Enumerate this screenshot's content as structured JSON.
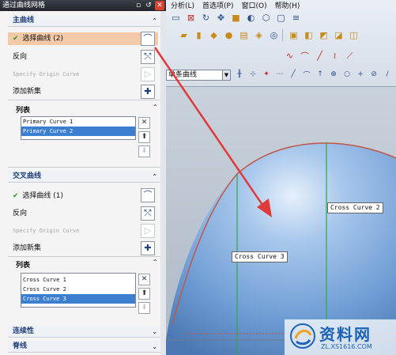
{
  "dialog": {
    "title": "通过曲线网格",
    "primary": {
      "header": "主曲线",
      "select_curve": "选择曲线 (2)",
      "reverse": "反向",
      "specify_origin": "Specify Origin Curve",
      "add_set": "添加新集",
      "list_header": "列表",
      "items": [
        "Primary Curve  1",
        "Primary Curve  2"
      ],
      "selected_index": 1
    },
    "cross": {
      "header": "交叉曲线",
      "select_curve": "选择曲线 (1)",
      "reverse": "反向",
      "specify_origin": "Specify Origin Curve",
      "add_set": "添加新集",
      "list_header": "列表",
      "items": [
        "Cross Curve  1",
        "Cross Curve  2",
        "Cross Curve  3"
      ],
      "selected_index": 2
    },
    "continuity_header": "连续性",
    "spine_header": "脊线"
  },
  "menubar": {
    "items": [
      "分析(L)",
      "首选项(P)",
      "窗口(O)",
      "帮助(H)"
    ]
  },
  "toolbar": {
    "filter_value": "单条曲线"
  },
  "viewport": {
    "labels": {
      "cross_curve_2": "Cross Curve  2",
      "cross_curve_3": "Cross Curve  3"
    }
  },
  "watermark": {
    "title": "资料网",
    "subtitle": "ZL.XS1616.COM"
  },
  "colors": {
    "surface": "#6f9fd6",
    "primary_curve": "#c0574a",
    "cross_curve": "#2ea84a",
    "arrow": "#e03a3a",
    "highlight_row": "#f4c9a8",
    "selection": "#3c7fd1"
  }
}
